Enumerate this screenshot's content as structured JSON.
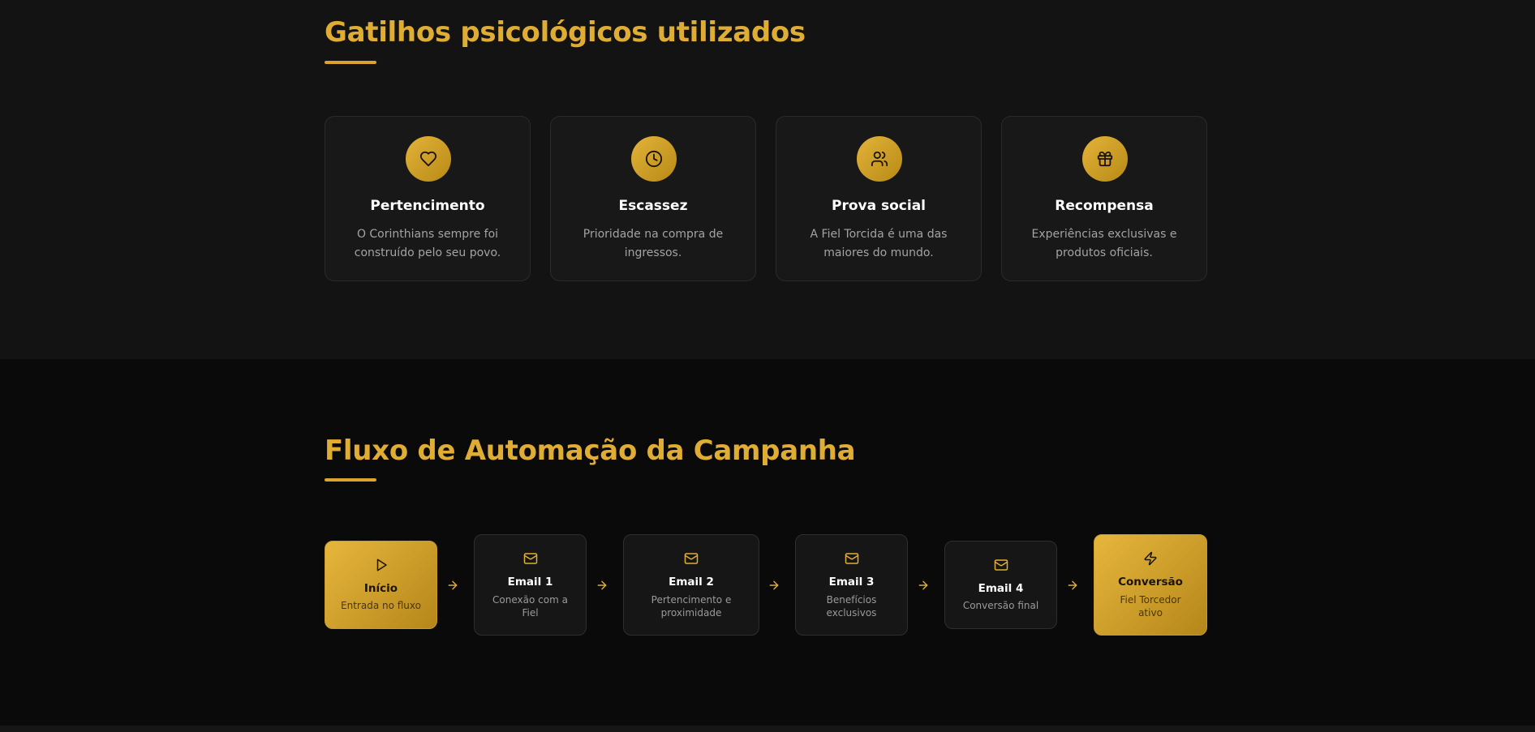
{
  "triggers_section": {
    "title": "Gatilhos psicológicos utilizados",
    "cards": [
      {
        "icon": "heart-icon",
        "title": "Pertencimento",
        "description": "O Corinthians sempre foi construído pelo seu povo."
      },
      {
        "icon": "clock-icon",
        "title": "Escassez",
        "description": "Prioridade na compra de ingressos."
      },
      {
        "icon": "users-icon",
        "title": "Prova social",
        "description": "A Fiel Torcida é uma das maiores do mundo."
      },
      {
        "icon": "gift-icon",
        "title": "Recompensa",
        "description": "Experiências exclusivas e produtos oficiais."
      }
    ]
  },
  "flow_section": {
    "title": "Fluxo de Automação da Campanha",
    "nodes": [
      {
        "icon": "play-icon",
        "title": "Início",
        "description": "Entrada no fluxo",
        "style": "gold"
      },
      {
        "icon": "mail-icon",
        "title": "Email 1",
        "description": "Conexão com a Fiel",
        "style": "dark"
      },
      {
        "icon": "mail-icon",
        "title": "Email 2",
        "description": "Pertencimento e proximidade",
        "style": "dark"
      },
      {
        "icon": "mail-icon",
        "title": "Email 3",
        "description": "Benefícios exclusivos",
        "style": "dark"
      },
      {
        "icon": "mail-icon",
        "title": "Email 4",
        "description": "Conversão final",
        "style": "dark"
      },
      {
        "icon": "zap-icon",
        "title": "Conversão",
        "description": "Fiel Torcedor ativo",
        "style": "gold"
      }
    ],
    "arrow_icon": "arrow-right-icon"
  },
  "colors": {
    "accent_gold": "#e0ad34",
    "background_top": "#131313",
    "background_bottom": "#0a0a0a",
    "card_background": "#181818"
  }
}
